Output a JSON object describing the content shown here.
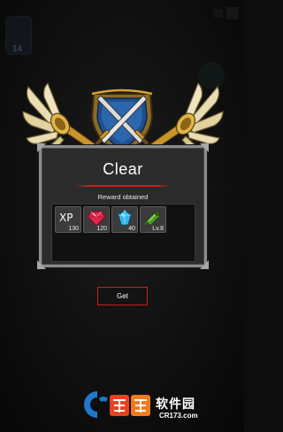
{
  "background": {
    "hero_level": "14"
  },
  "result": {
    "title": "Clear",
    "reward_label": "Reward obtained"
  },
  "rewards": [
    {
      "name": "xp",
      "label": "XP",
      "count": "130",
      "icon": "xp-icon"
    },
    {
      "name": "ruby",
      "label": "",
      "count": "120",
      "icon": "red-gem-icon"
    },
    {
      "name": "crystal",
      "label": "",
      "count": "40",
      "icon": "blue-crystal-icon"
    },
    {
      "name": "equipment",
      "label": "",
      "count": "Lv.8",
      "icon": "green-armor-icon"
    }
  ],
  "actions": {
    "get_label": "Get"
  },
  "watermark": {
    "brand_chinese": "软件园",
    "url": "CR173.com"
  },
  "colors": {
    "accent_red": "#d11c1c",
    "shield_blue": "#1f4f8f",
    "gold": "#d4a437",
    "wing_cream": "#e9ddb3"
  }
}
